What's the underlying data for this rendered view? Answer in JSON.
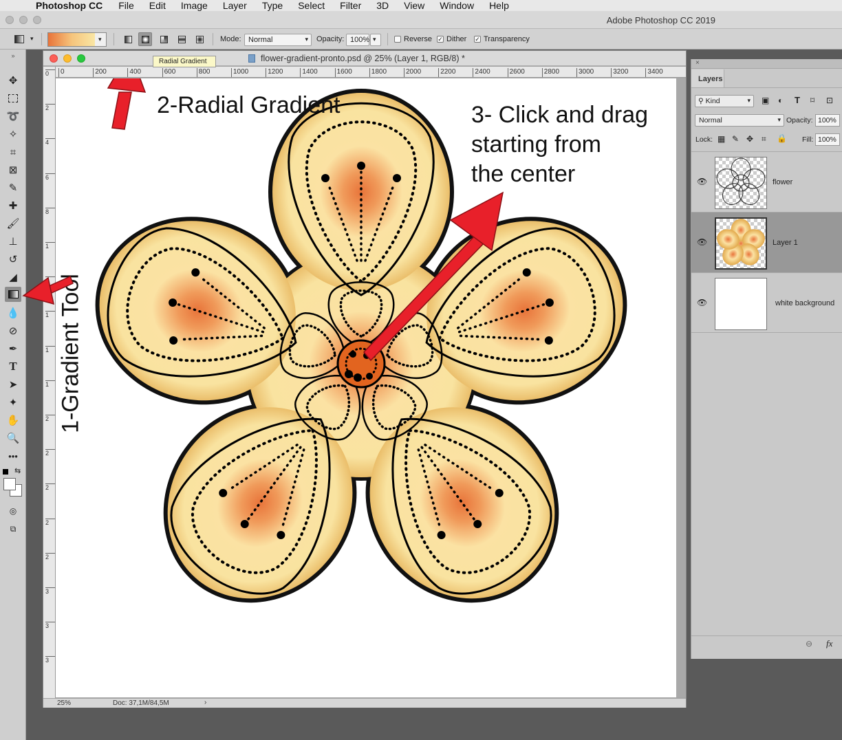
{
  "menubar": {
    "app": "Photoshop CC",
    "items": [
      "File",
      "Edit",
      "Image",
      "Layer",
      "Type",
      "Select",
      "Filter",
      "3D",
      "View",
      "Window",
      "Help"
    ]
  },
  "app_title": "Adobe Photoshop CC 2019",
  "options_bar": {
    "mode_label": "Mode:",
    "mode_value": "Normal",
    "opacity_label": "Opacity:",
    "opacity_value": "100%",
    "reverse_label": "Reverse",
    "reverse_checked": false,
    "dither_label": "Dither",
    "dither_checked": true,
    "transparency_label": "Transparency",
    "transparency_checked": true,
    "gradient_types": [
      "linear",
      "radial",
      "angle",
      "reflected",
      "diamond"
    ],
    "selected_gradient_type": "radial",
    "tooltip": "Radial Gradient"
  },
  "document": {
    "title": "flower-gradient-pronto.psd @ 25% (Layer 1, RGB/8) *",
    "zoom": "25%",
    "doc_info": "Doc: 37,1M/84,5M",
    "ruler_h": [
      "0",
      "200",
      "400",
      "600",
      "800",
      "1000",
      "1200",
      "1400",
      "1600",
      "1800",
      "2000",
      "2200",
      "2400",
      "2600",
      "2800",
      "3000",
      "3200",
      "3400"
    ],
    "ruler_v": [
      "0",
      "2",
      "4",
      "6",
      "8",
      "1",
      "1",
      "1",
      "1",
      "1",
      "2",
      "2",
      "2",
      "2",
      "2",
      "3",
      "3",
      "3"
    ]
  },
  "annotations": {
    "step1": "1-Gradient Tool",
    "step2": "2-Radial Gradient",
    "step3_line1": "3- Click and drag",
    "step3_line2": "starting from",
    "step3_line3": "the center"
  },
  "layers_panel": {
    "tab": "Layers",
    "filter_label": "Kind",
    "blend_mode": "Normal",
    "opacity_label": "Opacity:",
    "opacity_value": "100%",
    "lock_label": "Lock:",
    "fill_label": "Fill:",
    "fill_value": "100%",
    "layers": [
      {
        "name": "flower",
        "visible": true,
        "selected": false
      },
      {
        "name": "Layer 1",
        "visible": true,
        "selected": true
      },
      {
        "name": "white background",
        "visible": true,
        "selected": false
      }
    ],
    "footer_icons": [
      "link-icon",
      "fx-icon"
    ]
  },
  "colors": {
    "gradient_start": "#e8743a",
    "gradient_end": "#f9e6a4",
    "arrow": "#e8202a"
  }
}
